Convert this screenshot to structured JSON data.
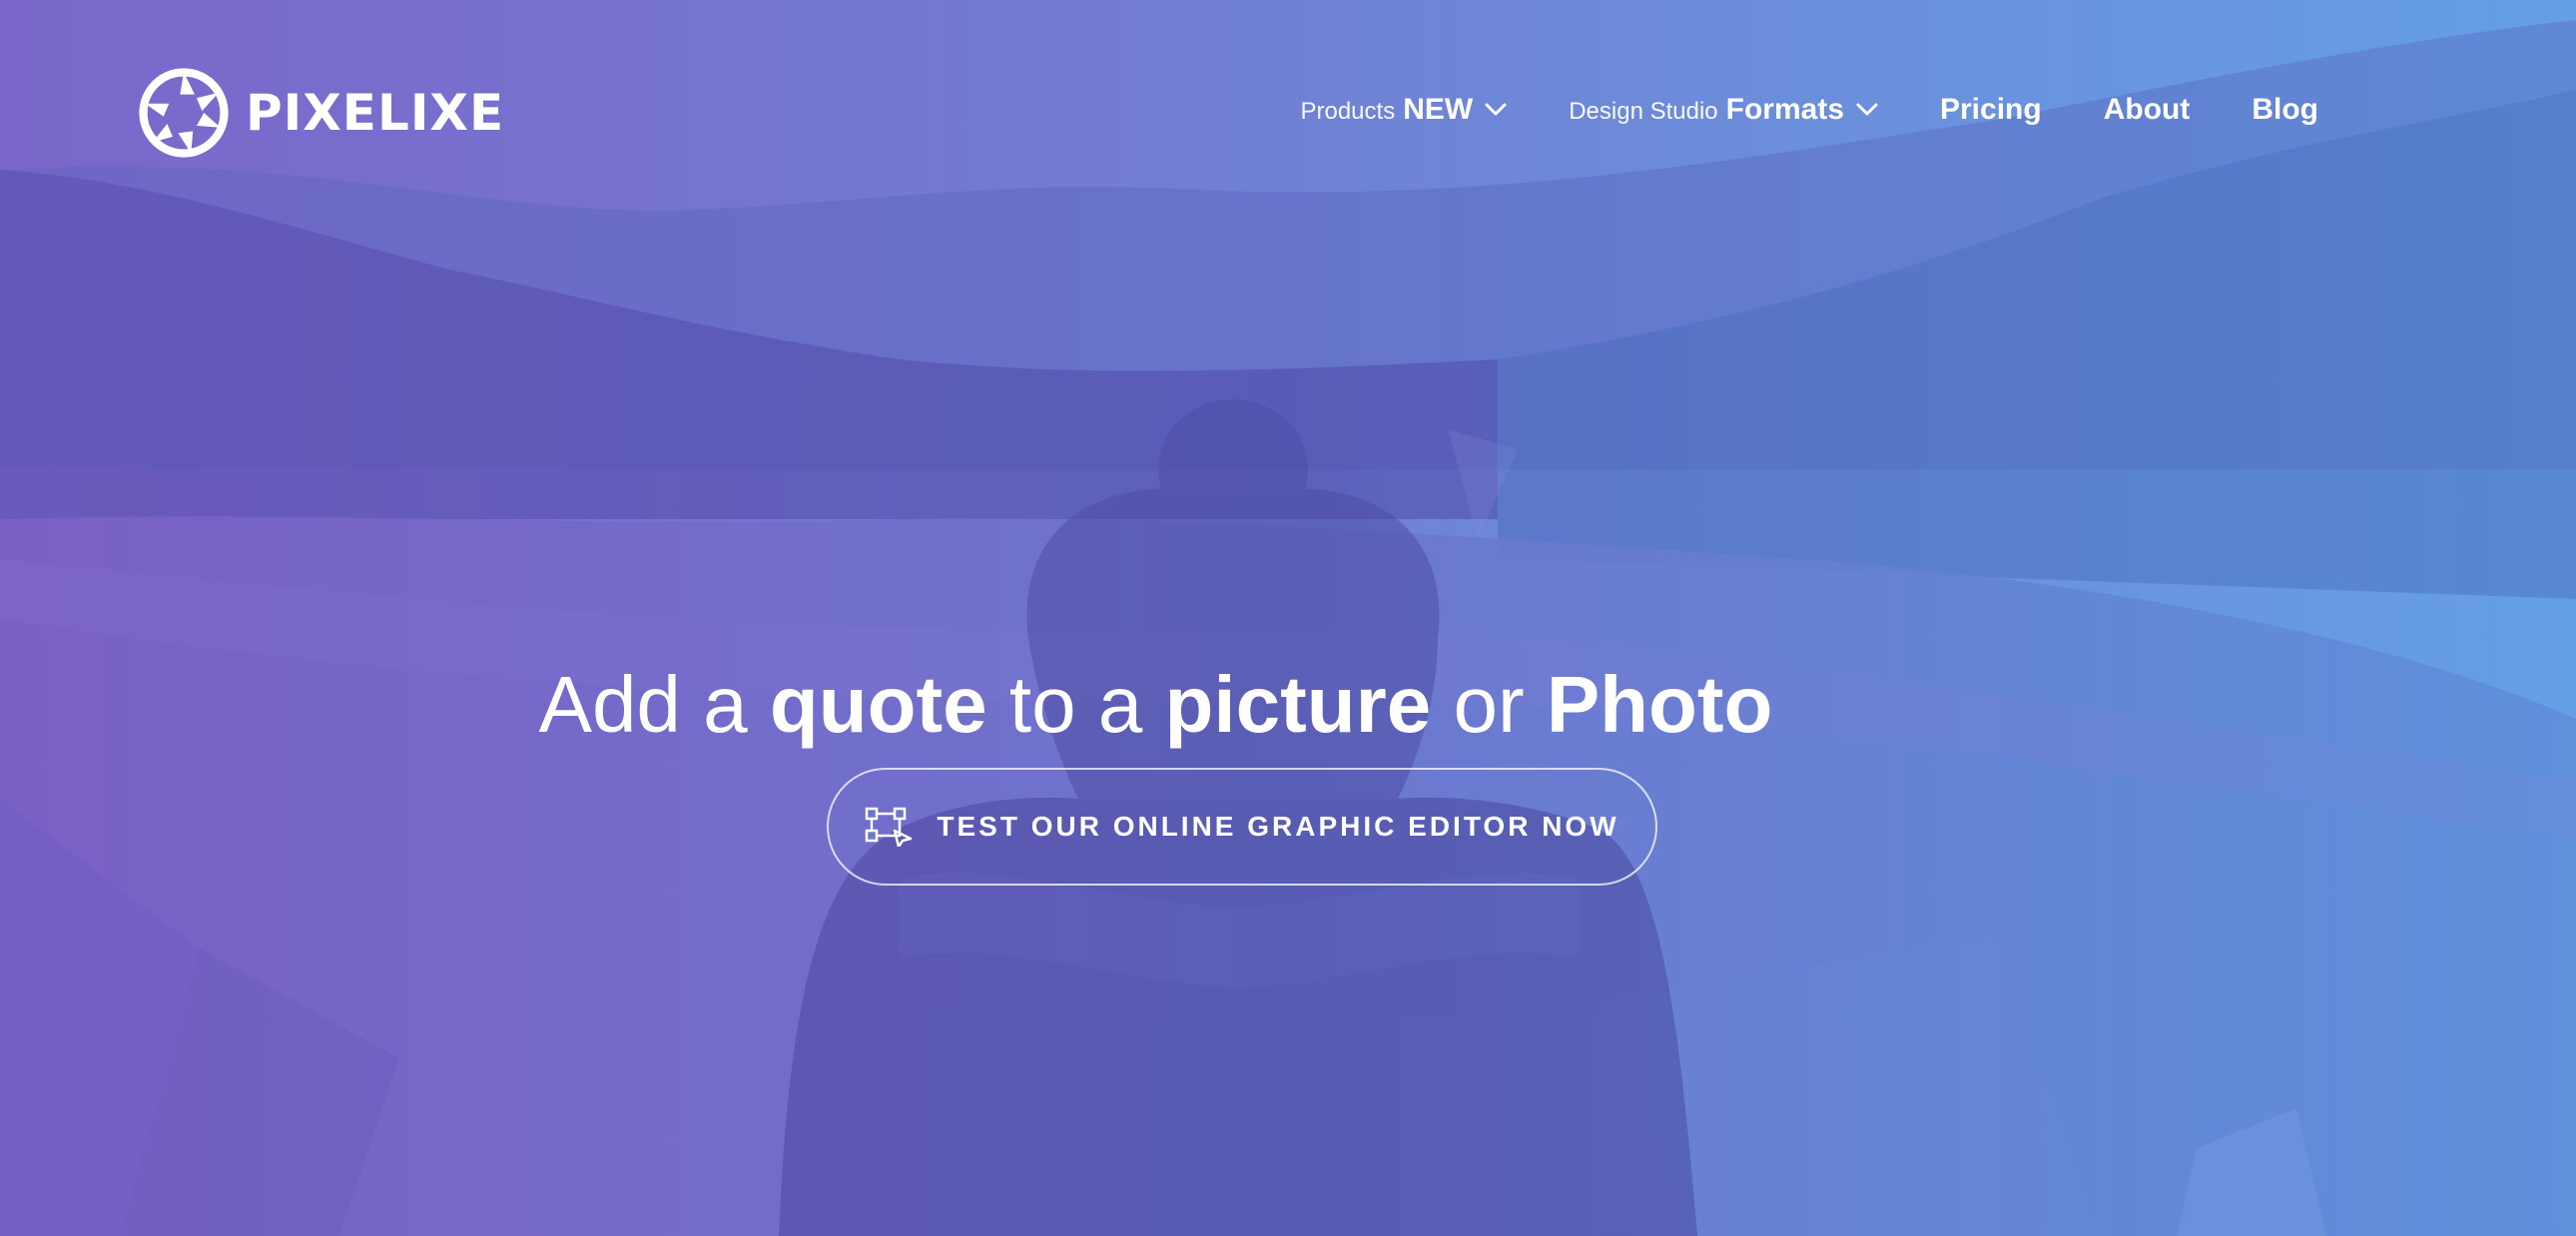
{
  "brand": {
    "name": "PIXELIXE",
    "logo_icon": "aperture-icon"
  },
  "nav": {
    "products": {
      "prefix": "Products",
      "label": "NEW",
      "icon": "chevron-down-icon"
    },
    "formats": {
      "prefix": "Design Studio",
      "label": "Formats",
      "icon": "chevron-down-icon"
    },
    "pricing": "Pricing",
    "about": "About",
    "blog": "Blog"
  },
  "hero": {
    "headline": {
      "part1": "Add a ",
      "part2": "quote",
      "part3": " to a ",
      "part4": "picture",
      "part5": " or ",
      "part6": "Photo"
    },
    "cta": {
      "label": "TEST OUR ONLINE GRAPHIC EDITOR NOW",
      "icon": "vector-shape-icon"
    }
  },
  "colors": {
    "gradient_left": "#7a66c9",
    "gradient_right": "#6aa0e6",
    "text": "#ffffff"
  }
}
